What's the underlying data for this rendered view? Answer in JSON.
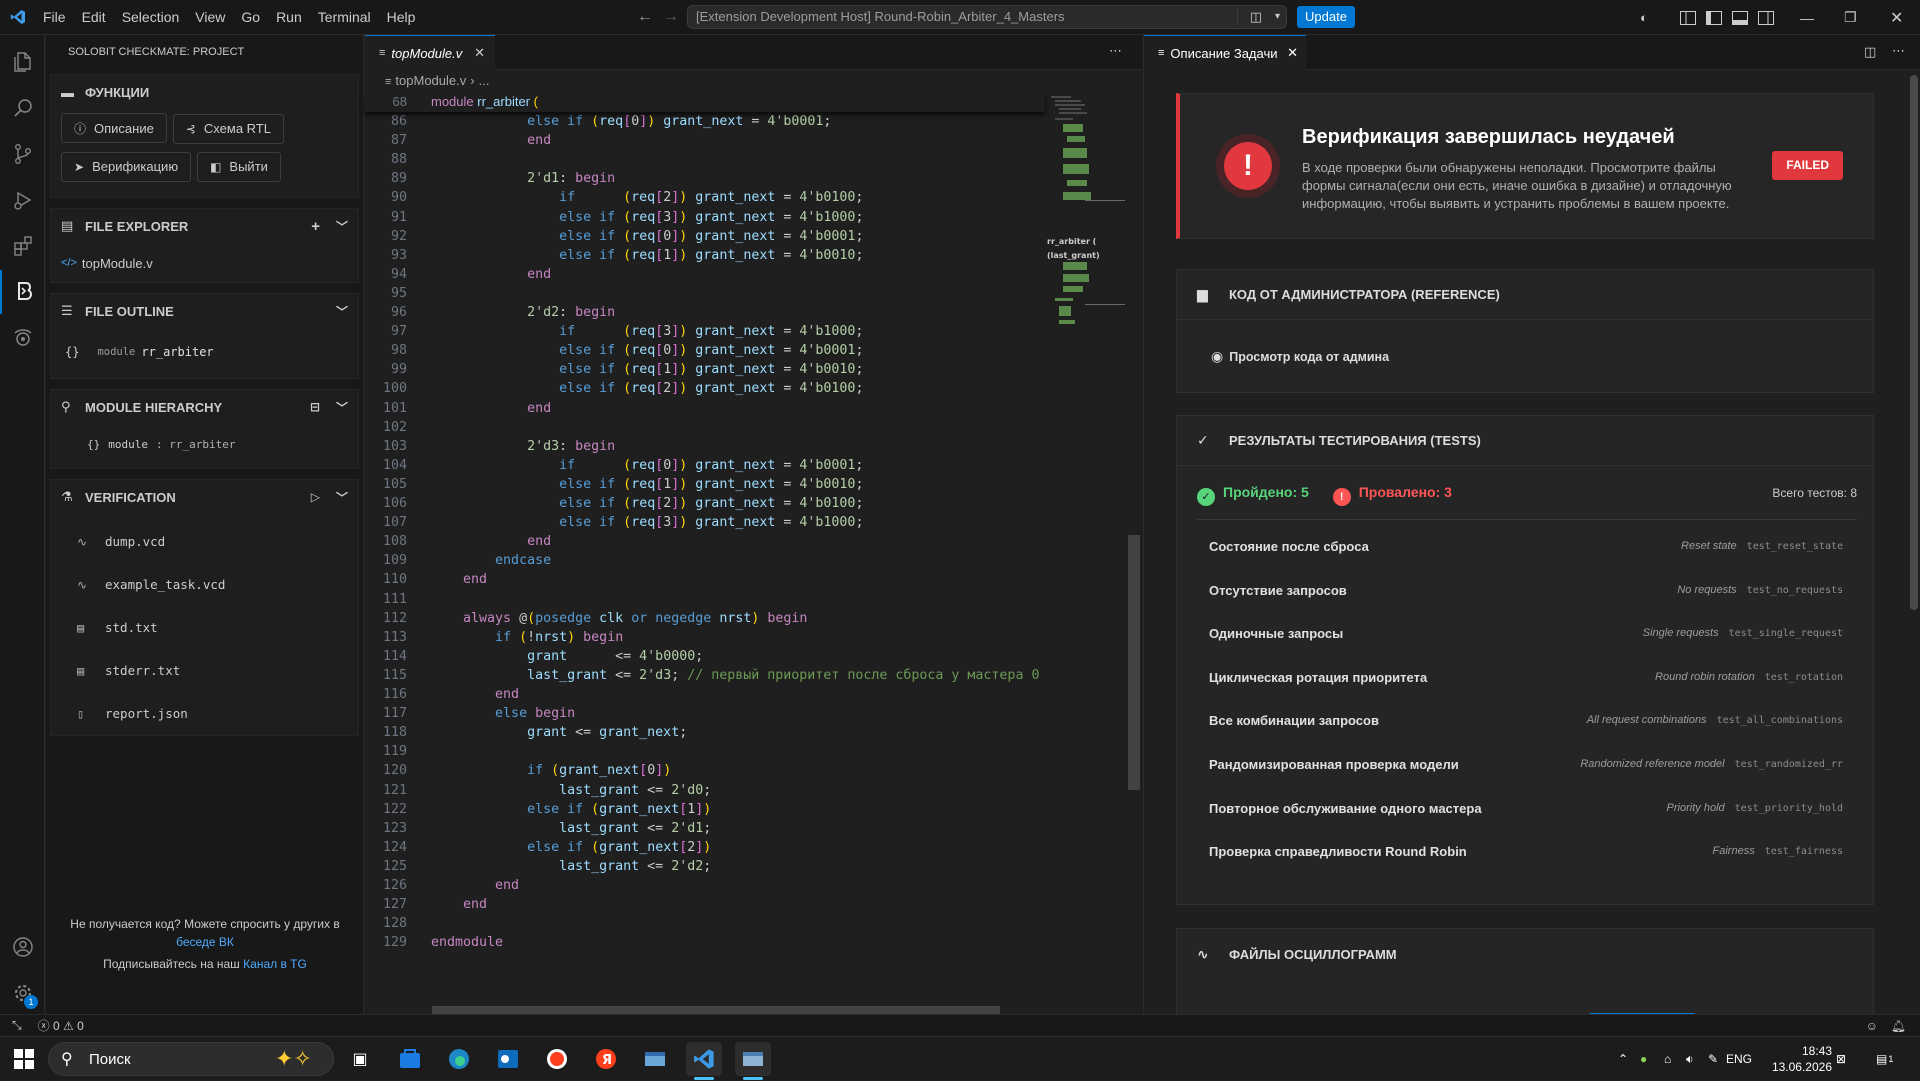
{
  "titlebar": {
    "menu": [
      "File",
      "Edit",
      "Selection",
      "View",
      "Go",
      "Run",
      "Terminal",
      "Help"
    ],
    "command_center": "[Extension Development Host] Round-Robin_Arbiter_4_Masters",
    "update_label": "Update"
  },
  "sidebar": {
    "title": "SOLOBIT CHECKMATE: PROJECT",
    "functions": {
      "header": "ФУНКЦИИ",
      "buttons": [
        "Описание",
        "Схема RTL",
        "Верификацию",
        "Выйти"
      ]
    },
    "explorer": {
      "header": "FILE EXPLORER",
      "files": [
        "topModule.v"
      ]
    },
    "outline": {
      "header": "FILE OUTLINE",
      "kind": "module",
      "name": "rr_arbiter"
    },
    "hierarchy": {
      "header": "MODULE HIERARCHY",
      "kind": "module",
      "name": ": rr_arbiter"
    },
    "verification": {
      "header": "VERIFICATION",
      "files": [
        "dump.vcd",
        "example_task.vcd",
        "std.txt",
        "stderr.txt",
        "report.json"
      ]
    },
    "footer": {
      "line1": "Не получается код? Можете спросить у других в",
      "link1": "беседе ВК",
      "line2": "Подписывайтесь на наш",
      "link2": "Канал в TG"
    }
  },
  "editor": {
    "tab": "topModule.v",
    "breadcrumb_file": "topModule.v",
    "breadcrumb_rest": "...",
    "sticky": {
      "ln": "68",
      "text": "module rr_arbiter ("
    },
    "lines": [
      {
        "ln": "86",
        "t": "            else if (req[0]) grant_next = 4'b0001;"
      },
      {
        "ln": "87",
        "t": "            end"
      },
      {
        "ln": "88",
        "t": ""
      },
      {
        "ln": "89",
        "t": "            2'd1: begin"
      },
      {
        "ln": "90",
        "t": "                if      (req[2]) grant_next = 4'b0100;"
      },
      {
        "ln": "91",
        "t": "                else if (req[3]) grant_next = 4'b1000;"
      },
      {
        "ln": "92",
        "t": "                else if (req[0]) grant_next = 4'b0001;"
      },
      {
        "ln": "93",
        "t": "                else if (req[1]) grant_next = 4'b0010;"
      },
      {
        "ln": "94",
        "t": "            end"
      },
      {
        "ln": "95",
        "t": ""
      },
      {
        "ln": "96",
        "t": "            2'd2: begin"
      },
      {
        "ln": "97",
        "t": "                if      (req[3]) grant_next = 4'b1000;"
      },
      {
        "ln": "98",
        "t": "                else if (req[0]) grant_next = 4'b0001;"
      },
      {
        "ln": "99",
        "t": "                else if (req[1]) grant_next = 4'b0010;"
      },
      {
        "ln": "100",
        "t": "                else if (req[2]) grant_next = 4'b0100;"
      },
      {
        "ln": "101",
        "t": "            end"
      },
      {
        "ln": "102",
        "t": ""
      },
      {
        "ln": "103",
        "t": "            2'd3: begin"
      },
      {
        "ln": "104",
        "t": "                if      (req[0]) grant_next = 4'b0001;"
      },
      {
        "ln": "105",
        "t": "                else if (req[1]) grant_next = 4'b0010;"
      },
      {
        "ln": "106",
        "t": "                else if (req[2]) grant_next = 4'b0100;"
      },
      {
        "ln": "107",
        "t": "                else if (req[3]) grant_next = 4'b1000;"
      },
      {
        "ln": "108",
        "t": "            end"
      },
      {
        "ln": "109",
        "t": "        endcase"
      },
      {
        "ln": "110",
        "t": "    end"
      },
      {
        "ln": "111",
        "t": ""
      },
      {
        "ln": "112",
        "t": "    always @(posedge clk or negedge nrst) begin"
      },
      {
        "ln": "113",
        "t": "        if (!nrst) begin"
      },
      {
        "ln": "114",
        "t": "            grant      <= 4'b0000;"
      },
      {
        "ln": "115",
        "t": "            last_grant <= 2'd3; // первый приоритет после сброса у мастера 0"
      },
      {
        "ln": "116",
        "t": "        end"
      },
      {
        "ln": "117",
        "t": "        else begin"
      },
      {
        "ln": "118",
        "t": "            grant <= grant_next;"
      },
      {
        "ln": "119",
        "t": ""
      },
      {
        "ln": "120",
        "t": "            if (grant_next[0])"
      },
      {
        "ln": "121",
        "t": "                last_grant <= 2'd0;"
      },
      {
        "ln": "122",
        "t": "            else if (grant_next[1])"
      },
      {
        "ln": "123",
        "t": "                last_grant <= 2'd1;"
      },
      {
        "ln": "124",
        "t": "            else if (grant_next[2])"
      },
      {
        "ln": "125",
        "t": "                last_grant <= 2'd2;"
      },
      {
        "ln": "126",
        "t": "        end"
      },
      {
        "ln": "127",
        "t": "    end"
      },
      {
        "ln": "128",
        "t": ""
      },
      {
        "ln": "129",
        "t": "endmodule"
      }
    ],
    "minimap_labels": [
      "rr_arbiter (",
      "(last_grant)"
    ]
  },
  "rpanel": {
    "tab": "Описание Задачи",
    "fail": {
      "title": "Верификация завершилась неудачей",
      "desc": "В ходе проверки были обнаружены неполадки. Просмотрите файлы формы сигнала(если они есть, иначе ошибка в дизайне) и отладочную информацию, чтобы выявить и устранить проблемы в вашем проекте.",
      "badge": "FAILED"
    },
    "admin": {
      "header": "КОД ОТ АДМИНИСТРАТОРА (REFERENCE)",
      "view": "Просмотр кода от админа"
    },
    "tests": {
      "header": "РЕЗУЛЬТАТЫ ТЕСТИРОВАНИЯ (TESTS)",
      "passed_label": "Пройдено:",
      "passed": "5",
      "failed_label": "Провалено:",
      "failed": "3",
      "total": "Всего тестов: 8",
      "rows": [
        {
          "name": "Состояние после сброса",
          "en": "Reset state",
          "id": "test_reset_state"
        },
        {
          "name": "Отсутствие запросов",
          "en": "No requests",
          "id": "test_no_requests"
        },
        {
          "name": "Одиночные запросы",
          "en": "Single requests",
          "id": "test_single_request"
        },
        {
          "name": "Циклическая ротация приоритета",
          "en": "Round robin rotation",
          "id": "test_rotation"
        },
        {
          "name": "Все комбинации запросов",
          "en": "All request combinations",
          "id": "test_all_combinations"
        },
        {
          "name": "Рандомизированная проверка модели",
          "en": "Randomized reference model",
          "id": "test_randomized_rr"
        },
        {
          "name": "Повторное обслуживание одного мастера",
          "en": "Priority hold",
          "id": "test_priority_hold"
        },
        {
          "name": "Проверка справедливости Round Robin",
          "en": "Fairness",
          "id": "test_fairness"
        }
      ]
    },
    "waves": {
      "header": "ФАЙЛЫ ОСЦИЛЛОГРАММ"
    }
  },
  "status": {
    "errors": "0",
    "warnings": "0"
  },
  "taskbar": {
    "search": "Поиск",
    "lang": "ENG",
    "time": "18:43",
    "date": "13.06.2026",
    "notif": "1"
  },
  "colors": {
    "accent": "#0078d4",
    "fail": "#e0383c",
    "pass": "#57d57a"
  }
}
